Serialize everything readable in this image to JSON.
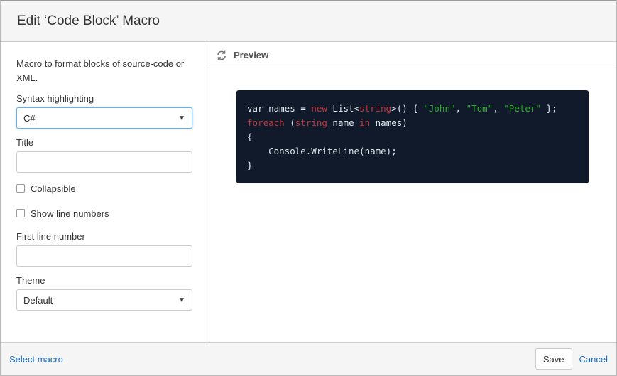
{
  "dialog": {
    "title": "Edit ‘Code Block’ Macro"
  },
  "form": {
    "description": "Macro to format blocks of source-code or XML.",
    "syntax_label": "Syntax highlighting",
    "syntax_value": "C#",
    "title_label": "Title",
    "title_value": "",
    "collapsible_label": "Collapsible",
    "line_numbers_label": "Show line numbers",
    "first_line_label": "First line number",
    "first_line_value": "",
    "theme_label": "Theme",
    "theme_value": "Default"
  },
  "preview": {
    "label": "Preview",
    "code": [
      [
        [
          "var names = ",
          "t"
        ],
        [
          "new",
          "k"
        ],
        [
          " List<",
          "t"
        ],
        [
          "string",
          "k"
        ],
        [
          ">() { ",
          "t"
        ],
        [
          "\"John\"",
          "s"
        ],
        [
          ", ",
          "t"
        ],
        [
          "\"Tom\"",
          "s"
        ],
        [
          ", ",
          "t"
        ],
        [
          "\"Peter\"",
          "s"
        ],
        [
          " };",
          "t"
        ]
      ],
      [
        [
          "foreach",
          "k"
        ],
        [
          " (",
          "t"
        ],
        [
          "string",
          "k"
        ],
        [
          " name ",
          "t"
        ],
        [
          "in",
          "k"
        ],
        [
          " names)",
          "t"
        ]
      ],
      [
        [
          "{",
          "t"
        ]
      ],
      [
        [
          "    Console.WriteLine(name);",
          "t"
        ]
      ],
      [
        [
          "}",
          "t"
        ]
      ]
    ],
    "colors": {
      "t": "#dfe6ee",
      "k": "#c0353b",
      "s": "#2eaa2e"
    }
  },
  "footer": {
    "select_macro": "Select macro",
    "save": "Save",
    "cancel": "Cancel"
  }
}
